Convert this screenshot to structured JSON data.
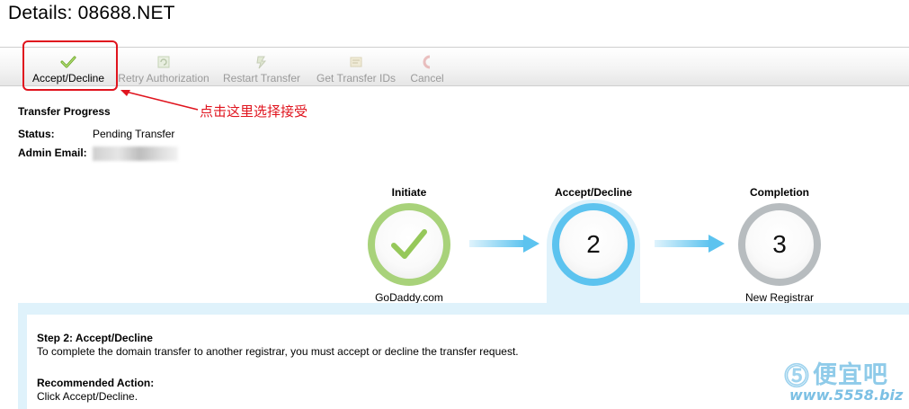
{
  "page": {
    "title": "Details: 08688.NET"
  },
  "toolbar": {
    "items": [
      {
        "label": "Accept/Decline",
        "icon": "checkmark-icon",
        "enabled": true
      },
      {
        "label": "Retry Authorization",
        "icon": "retry-icon",
        "enabled": false
      },
      {
        "label": "Restart Transfer",
        "icon": "restart-icon",
        "enabled": false
      },
      {
        "label": "Get Transfer IDs",
        "icon": "transfer-ids-icon",
        "enabled": false
      },
      {
        "label": "Cancel",
        "icon": "cancel-icon",
        "enabled": false
      }
    ]
  },
  "annotation": {
    "text": "点击这里选择接受",
    "color": "#e0141e"
  },
  "transfer": {
    "section_title": "Transfer Progress",
    "status_label": "Status:",
    "status_value": "Pending Transfer",
    "email_label": "Admin Email:"
  },
  "steps": [
    {
      "title": "Initiate",
      "subtitle": "GoDaddy.com",
      "state": "complete",
      "color": "#a8d27a"
    },
    {
      "title": "Accept/Decline",
      "number": "2",
      "state": "active",
      "color": "#5cc3ef"
    },
    {
      "title": "Completion",
      "number": "3",
      "subtitle": "New Registrar",
      "state": "pending",
      "color": "#b7bcbf"
    }
  ],
  "step_detail": {
    "heading": "Step 2: Accept/Decline",
    "description": "To complete the domain transfer to another registrar, you must accept or decline the transfer request.",
    "action_heading": "Recommended Action:",
    "action_text": "Click Accept/Decline."
  },
  "watermark": {
    "brand": "便宜吧",
    "url": "www.5558.biz",
    "color": "#8fcbe9"
  }
}
